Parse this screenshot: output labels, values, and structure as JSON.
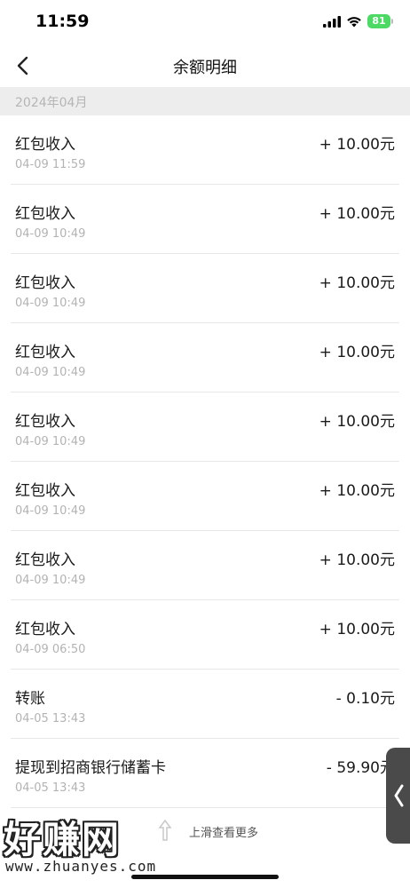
{
  "status_bar": {
    "time": "11:59",
    "battery": "81"
  },
  "nav": {
    "title": "余额明细"
  },
  "month_header": "2024年04月",
  "transactions": [
    {
      "title": "红包收入",
      "time": "04-09 11:59",
      "amount": "+ 10.00元"
    },
    {
      "title": "红包收入",
      "time": "04-09 10:49",
      "amount": "+ 10.00元"
    },
    {
      "title": "红包收入",
      "time": "04-09 10:49",
      "amount": "+ 10.00元"
    },
    {
      "title": "红包收入",
      "time": "04-09 10:49",
      "amount": "+ 10.00元"
    },
    {
      "title": "红包收入",
      "time": "04-09 10:49",
      "amount": "+ 10.00元"
    },
    {
      "title": "红包收入",
      "time": "04-09 10:49",
      "amount": "+ 10.00元"
    },
    {
      "title": "红包收入",
      "time": "04-09 10:49",
      "amount": "+ 10.00元"
    },
    {
      "title": "红包收入",
      "time": "04-09 06:50",
      "amount": "+ 10.00元"
    },
    {
      "title": "转账",
      "time": "04-05 13:43",
      "amount": "- 0.10元"
    },
    {
      "title": "提现到招商银行储蓄卡",
      "time": "04-05 13:43",
      "amount": "- 59.90元"
    }
  ],
  "load_more": {
    "label": "上滑查看更多"
  },
  "watermark": {
    "text": "好赚网",
    "url": "www.zhuanyes.com"
  }
}
